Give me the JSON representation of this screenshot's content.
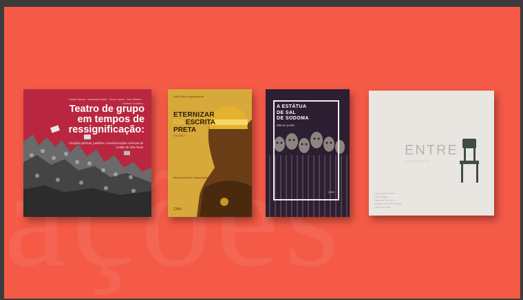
{
  "watermark": "ações",
  "books": [
    {
      "title": "Teatro de grupo em tempos de ressignificação:",
      "authors": "Carlos Souza · Alexandre Mate · Paulo Lopes · Ana Martins · Daniela Cordeiro",
      "subtitle": "Criações políticas, partilhas e transformações coletivas da Cidade de São Paulo"
    },
    {
      "title_line1": "ETERNIZAR",
      "title_line2_accent": "EM",
      "title_line2": "ESCRITA",
      "title_line3": "PRETA",
      "header": "Edith Silva\nOrganizadora",
      "small": "VOLUME II",
      "organizer": "Marcos Antônio\nOrganizador",
      "logo": "ÇAIA"
    },
    {
      "title": "A ESTÁTUA\nDE SAL\nDE SODOMA",
      "author": "Marcio ponte",
      "logo": "ÇAIA"
    },
    {
      "title": "ENTRE",
      "subtitle": "ALGUMAS TEXTOS",
      "credits": "José Alves Pereira\nLíbia Bagge\nMaria da Lux Sol\nFabiana da Silva Pereira\nLuiza da Costa"
    }
  ]
}
